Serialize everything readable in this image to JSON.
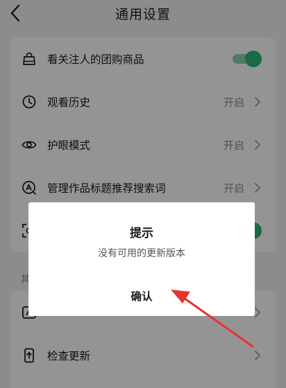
{
  "header": {
    "title": "通用设置",
    "back_icon": "chevron-left-icon"
  },
  "settings_card": {
    "items": [
      {
        "label": "看关注人的团购商品",
        "icon": "shopping-bag-icon",
        "control": "toggle",
        "toggle_on": true
      },
      {
        "label": "观看历史",
        "icon": "clock-icon",
        "value": "开启",
        "control": "chevron"
      },
      {
        "label": "护眼模式",
        "icon": "eye-icon",
        "value": "开启",
        "control": "chevron"
      },
      {
        "label": "管理作品标题推荐搜索词",
        "icon": "search-a-icon",
        "value": "开启",
        "control": "chevron"
      },
      {
        "icon": "scan-icon",
        "control": "toggle",
        "toggle_on": true
      }
    ]
  },
  "section2": {
    "label_partial": "其",
    "items": [
      {
        "icon": "image-a-icon",
        "control": "chevron"
      },
      {
        "label": "检查更新",
        "icon": "phone-upload-icon",
        "control": "chevron"
      }
    ]
  },
  "dialog": {
    "title": "提示",
    "message": "没有可用的更新版本",
    "confirm_label": "确认"
  },
  "colors": {
    "toggle_on": "#2db878",
    "toggle_track": "#88d3ad",
    "annotation_arrow": "#e8332c"
  }
}
